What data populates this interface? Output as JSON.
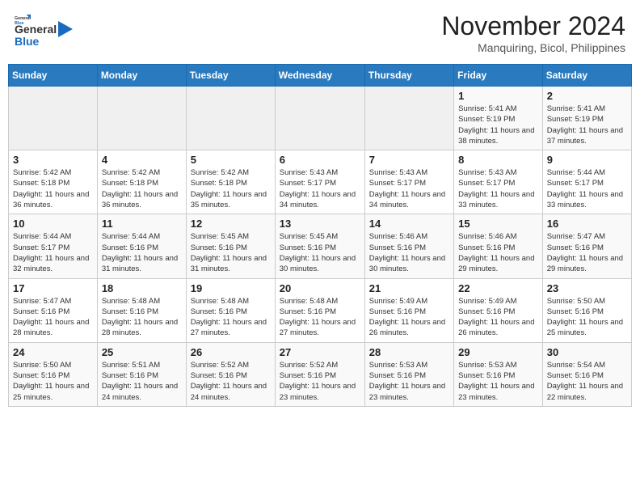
{
  "header": {
    "logo": {
      "general": "General",
      "blue": "Blue"
    },
    "title": "November 2024",
    "location": "Manquiring, Bicol, Philippines"
  },
  "weekdays": [
    "Sunday",
    "Monday",
    "Tuesday",
    "Wednesday",
    "Thursday",
    "Friday",
    "Saturday"
  ],
  "weeks": [
    [
      {
        "day": "",
        "info": ""
      },
      {
        "day": "",
        "info": ""
      },
      {
        "day": "",
        "info": ""
      },
      {
        "day": "",
        "info": ""
      },
      {
        "day": "",
        "info": ""
      },
      {
        "day": "1",
        "info": "Sunrise: 5:41 AM\nSunset: 5:19 PM\nDaylight: 11 hours and 38 minutes."
      },
      {
        "day": "2",
        "info": "Sunrise: 5:41 AM\nSunset: 5:19 PM\nDaylight: 11 hours and 37 minutes."
      }
    ],
    [
      {
        "day": "3",
        "info": "Sunrise: 5:42 AM\nSunset: 5:18 PM\nDaylight: 11 hours and 36 minutes."
      },
      {
        "day": "4",
        "info": "Sunrise: 5:42 AM\nSunset: 5:18 PM\nDaylight: 11 hours and 36 minutes."
      },
      {
        "day": "5",
        "info": "Sunrise: 5:42 AM\nSunset: 5:18 PM\nDaylight: 11 hours and 35 minutes."
      },
      {
        "day": "6",
        "info": "Sunrise: 5:43 AM\nSunset: 5:17 PM\nDaylight: 11 hours and 34 minutes."
      },
      {
        "day": "7",
        "info": "Sunrise: 5:43 AM\nSunset: 5:17 PM\nDaylight: 11 hours and 34 minutes."
      },
      {
        "day": "8",
        "info": "Sunrise: 5:43 AM\nSunset: 5:17 PM\nDaylight: 11 hours and 33 minutes."
      },
      {
        "day": "9",
        "info": "Sunrise: 5:44 AM\nSunset: 5:17 PM\nDaylight: 11 hours and 33 minutes."
      }
    ],
    [
      {
        "day": "10",
        "info": "Sunrise: 5:44 AM\nSunset: 5:17 PM\nDaylight: 11 hours and 32 minutes."
      },
      {
        "day": "11",
        "info": "Sunrise: 5:44 AM\nSunset: 5:16 PM\nDaylight: 11 hours and 31 minutes."
      },
      {
        "day": "12",
        "info": "Sunrise: 5:45 AM\nSunset: 5:16 PM\nDaylight: 11 hours and 31 minutes."
      },
      {
        "day": "13",
        "info": "Sunrise: 5:45 AM\nSunset: 5:16 PM\nDaylight: 11 hours and 30 minutes."
      },
      {
        "day": "14",
        "info": "Sunrise: 5:46 AM\nSunset: 5:16 PM\nDaylight: 11 hours and 30 minutes."
      },
      {
        "day": "15",
        "info": "Sunrise: 5:46 AM\nSunset: 5:16 PM\nDaylight: 11 hours and 29 minutes."
      },
      {
        "day": "16",
        "info": "Sunrise: 5:47 AM\nSunset: 5:16 PM\nDaylight: 11 hours and 29 minutes."
      }
    ],
    [
      {
        "day": "17",
        "info": "Sunrise: 5:47 AM\nSunset: 5:16 PM\nDaylight: 11 hours and 28 minutes."
      },
      {
        "day": "18",
        "info": "Sunrise: 5:48 AM\nSunset: 5:16 PM\nDaylight: 11 hours and 28 minutes."
      },
      {
        "day": "19",
        "info": "Sunrise: 5:48 AM\nSunset: 5:16 PM\nDaylight: 11 hours and 27 minutes."
      },
      {
        "day": "20",
        "info": "Sunrise: 5:48 AM\nSunset: 5:16 PM\nDaylight: 11 hours and 27 minutes."
      },
      {
        "day": "21",
        "info": "Sunrise: 5:49 AM\nSunset: 5:16 PM\nDaylight: 11 hours and 26 minutes."
      },
      {
        "day": "22",
        "info": "Sunrise: 5:49 AM\nSunset: 5:16 PM\nDaylight: 11 hours and 26 minutes."
      },
      {
        "day": "23",
        "info": "Sunrise: 5:50 AM\nSunset: 5:16 PM\nDaylight: 11 hours and 25 minutes."
      }
    ],
    [
      {
        "day": "24",
        "info": "Sunrise: 5:50 AM\nSunset: 5:16 PM\nDaylight: 11 hours and 25 minutes."
      },
      {
        "day": "25",
        "info": "Sunrise: 5:51 AM\nSunset: 5:16 PM\nDaylight: 11 hours and 24 minutes."
      },
      {
        "day": "26",
        "info": "Sunrise: 5:52 AM\nSunset: 5:16 PM\nDaylight: 11 hours and 24 minutes."
      },
      {
        "day": "27",
        "info": "Sunrise: 5:52 AM\nSunset: 5:16 PM\nDaylight: 11 hours and 23 minutes."
      },
      {
        "day": "28",
        "info": "Sunrise: 5:53 AM\nSunset: 5:16 PM\nDaylight: 11 hours and 23 minutes."
      },
      {
        "day": "29",
        "info": "Sunrise: 5:53 AM\nSunset: 5:16 PM\nDaylight: 11 hours and 23 minutes."
      },
      {
        "day": "30",
        "info": "Sunrise: 5:54 AM\nSunset: 5:16 PM\nDaylight: 11 hours and 22 minutes."
      }
    ]
  ]
}
